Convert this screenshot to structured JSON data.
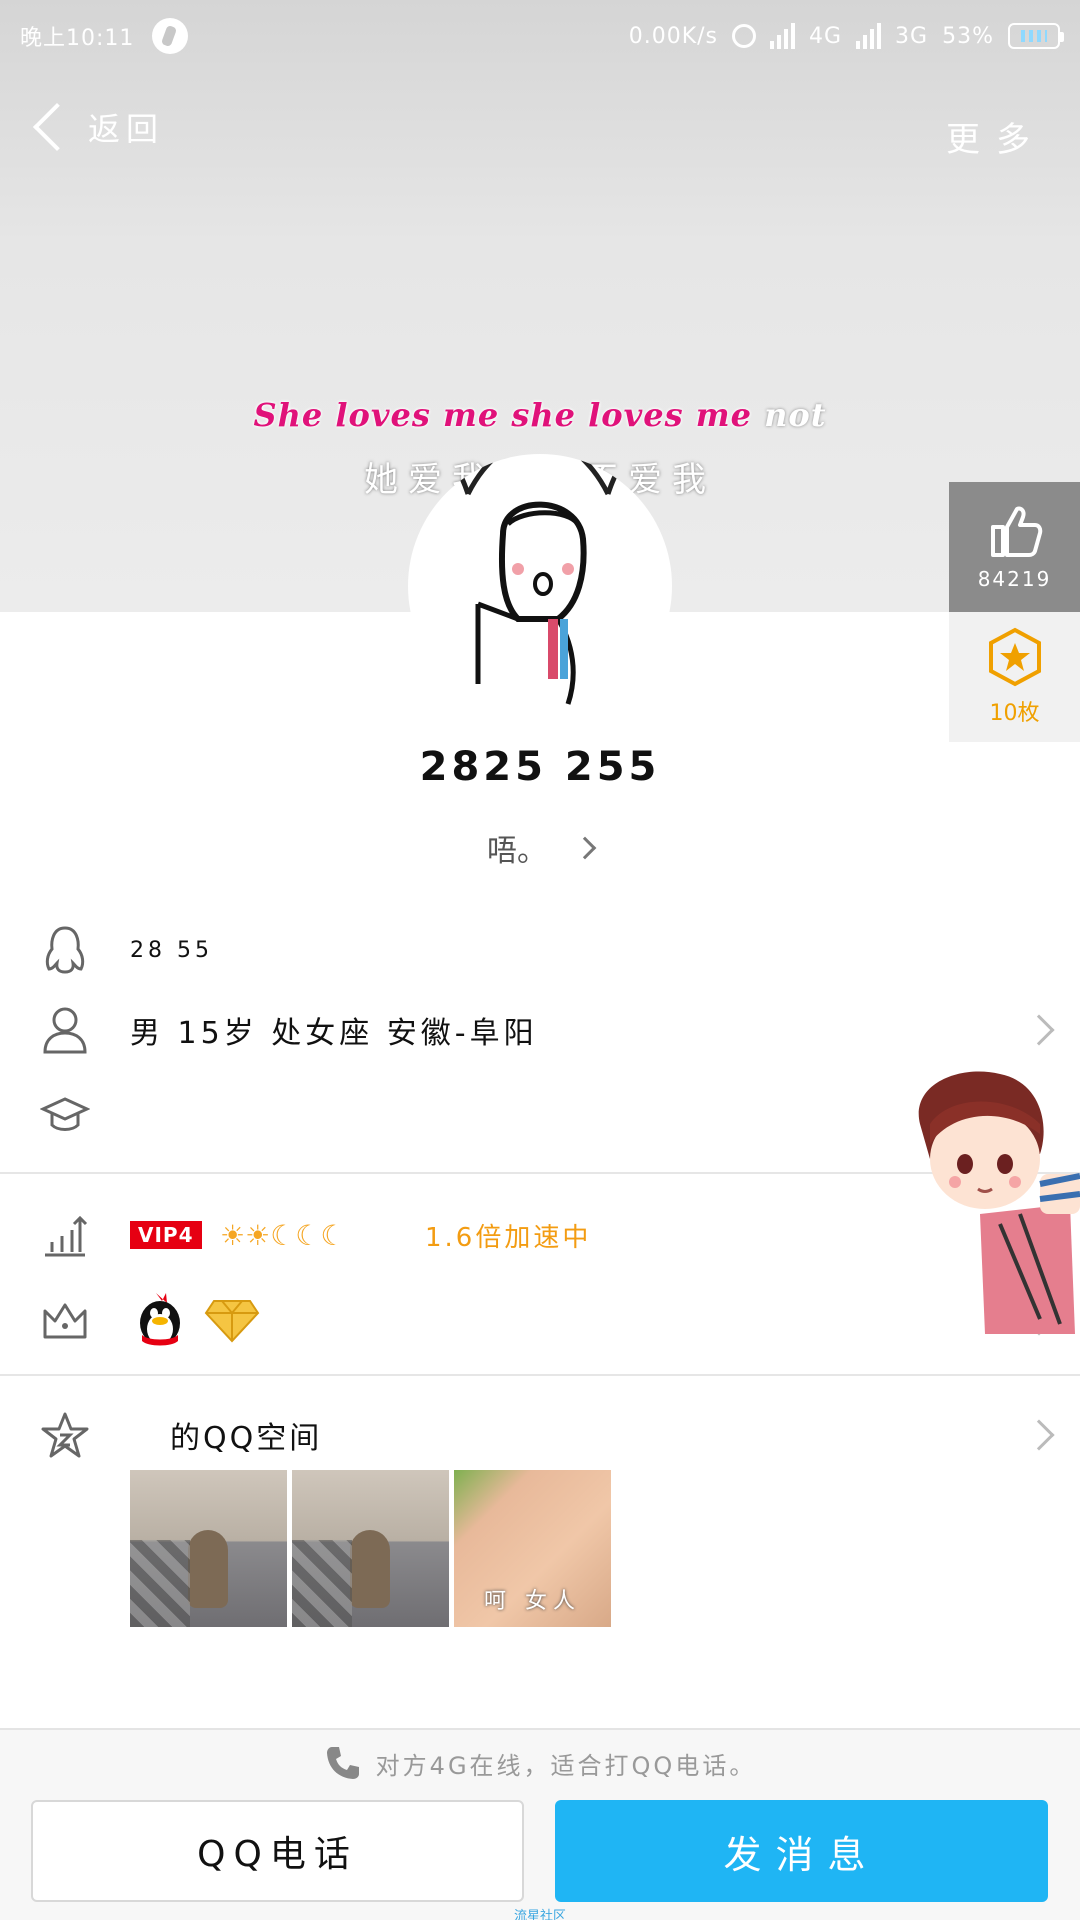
{
  "status_bar": {
    "time": "晚上10:11",
    "net_speed": "0.00K/s",
    "net1": "4G",
    "net2": "3G",
    "battery": "53%"
  },
  "nav": {
    "back_label": "返回",
    "more_label": "更多"
  },
  "lyrics": {
    "line_en_highlight": "She loves me she loves me",
    "line_en_rest": " not",
    "line_cn": "她爱我，她不爱我"
  },
  "side": {
    "likes": "84219",
    "badges": "10枚"
  },
  "profile": {
    "name": "2825    255",
    "signature": "唔。",
    "qq_number": "28        55",
    "basic_info": "男  15岁  处女座  安徽-阜阳",
    "school": ""
  },
  "vip": {
    "badge": "VIP4",
    "level_icons": "☀☀☾☾☾",
    "speed": "1.6倍加速中"
  },
  "qzone": {
    "title": "的QQ空间",
    "photo_caption": "呵 女人"
  },
  "footer": {
    "call_tip": "对方4G在线，适合打QQ电话。",
    "call_button": "QQ电话",
    "message_button": "发消息",
    "watermark": "流星社区"
  },
  "icons": {
    "qq": "penguin-outline-icon",
    "person": "person-icon",
    "school": "graduation-cap-icon",
    "level": "level-chart-icon",
    "crown": "crown-icon",
    "qzone": "star-icon",
    "phone": "phone-icon",
    "like": "thumbs-up-icon",
    "badge": "star-badge-icon"
  },
  "colors": {
    "primary_blue": "#1fb5f4",
    "lyric_pink": "#e0127a",
    "vip_red": "#e60012",
    "speed_orange": "#f39c12"
  }
}
